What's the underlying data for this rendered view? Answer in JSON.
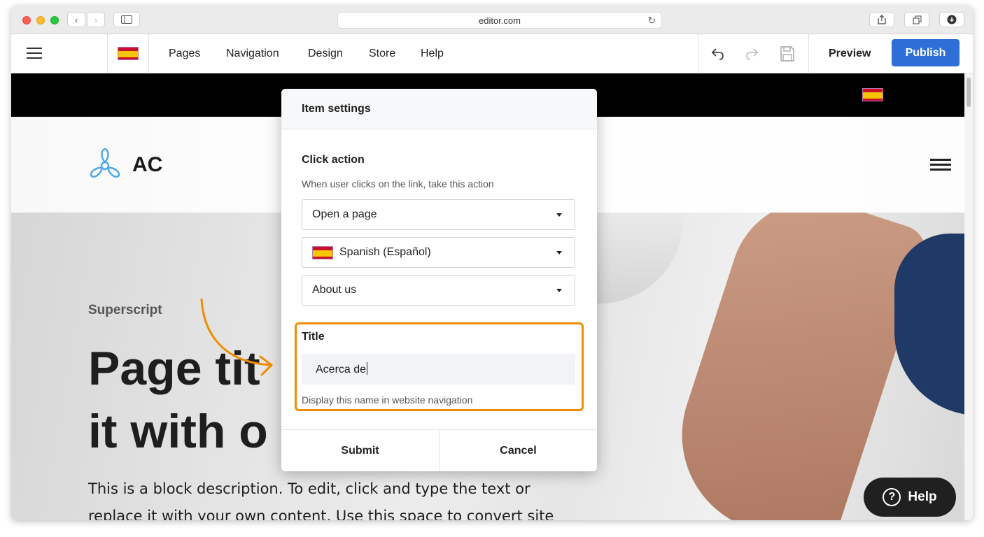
{
  "browser": {
    "url": "editor.com"
  },
  "toolbar": {
    "nav": [
      "Pages",
      "Navigation",
      "Design",
      "Store",
      "Help"
    ],
    "preview_label": "Preview",
    "publish_label": "Publish",
    "icons": [
      "hamburger-icon",
      "spain-flag-icon",
      "undo-icon",
      "redo-icon",
      "save-icon"
    ]
  },
  "site": {
    "logo_text": "AC",
    "superscript": "Superscript",
    "page_title_line1": "Page tit",
    "page_title_line2": "it with o",
    "description": "This is a block description. To edit, click and type the text or replace it with your own content. Use this space to convert site visitors into",
    "help_label": "Help"
  },
  "modal": {
    "title": "Item settings",
    "click_action_label": "Click action",
    "click_action_helper": "When user clicks on the link, take this action",
    "action_select": "Open a page",
    "language_select": "Spanish (Español)",
    "page_select": "About us",
    "title_label": "Title",
    "title_value": "Acerca de",
    "title_helper": "Display this name in website navigation",
    "submit_label": "Submit",
    "cancel_label": "Cancel"
  },
  "colors": {
    "publish": "#2d6fd7",
    "highlight": "#f08c00",
    "logo": "#4aa8e8"
  }
}
